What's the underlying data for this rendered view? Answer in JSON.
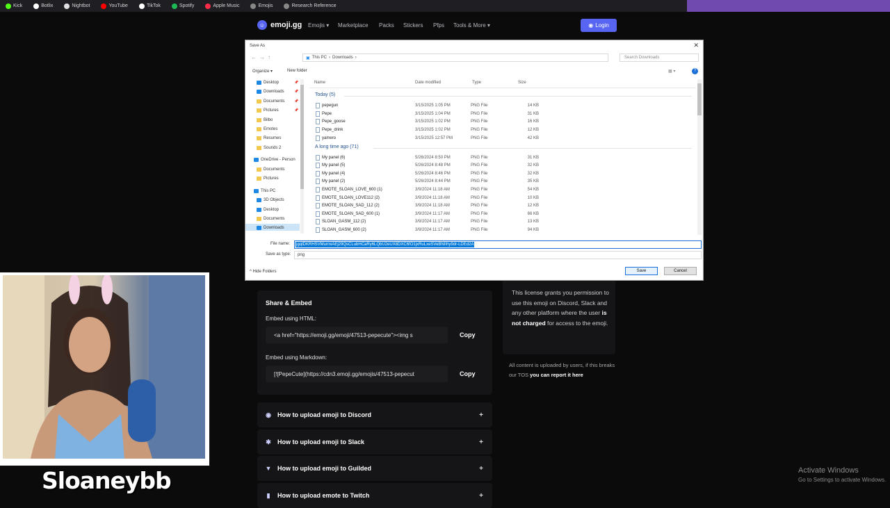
{
  "bookmarks": [
    {
      "label": "Kick",
      "color": "#53fc18"
    },
    {
      "label": "Botlix",
      "color": "#ffffff"
    },
    {
      "label": "Nightbot",
      "color": "#e0e0e0"
    },
    {
      "label": "YouTube",
      "color": "#ff0000"
    },
    {
      "label": "TikTok",
      "color": "#ffffff"
    },
    {
      "label": "Spotify",
      "color": "#1db954"
    },
    {
      "label": "Apple Music",
      "color": "#fa2d48"
    },
    {
      "label": "Emojis",
      "color": "#888888"
    },
    {
      "label": "Research Reference",
      "color": "#888888"
    }
  ],
  "site": {
    "logo_text": "emoji.gg",
    "nav": [
      "Emojis ▾",
      "Marketplace",
      "Packs",
      "Stickers",
      "Pfps",
      "Tools & More ▾"
    ],
    "login_label": "Login"
  },
  "dialog": {
    "title": "Save As",
    "close": "✕",
    "address": [
      "This PC",
      "›",
      "Downloads",
      "›"
    ],
    "search_placeholder": "Search Downloads",
    "organize": "Organize ▾",
    "new_folder": "New folder",
    "nav_items": [
      {
        "label": "Desktop",
        "icon": "folder-blue",
        "pinned": true
      },
      {
        "label": "Downloads",
        "icon": "download-arrow",
        "pinned": true
      },
      {
        "label": "Documents",
        "icon": "folder",
        "pinned": true
      },
      {
        "label": "Pictures",
        "icon": "folder",
        "pinned": true
      },
      {
        "label": "Bilbo",
        "icon": "folder",
        "pinned": false
      },
      {
        "label": "Emotes",
        "icon": "folder",
        "pinned": false
      },
      {
        "label": "Resumes",
        "icon": "folder",
        "pinned": false
      },
      {
        "label": "Sounds 2",
        "icon": "folder",
        "pinned": false
      },
      {
        "label": "OneDrive - Person",
        "icon": "cloud",
        "pinned": false
      },
      {
        "label": "Documents",
        "icon": "folder",
        "pinned": false
      },
      {
        "label": "Pictures",
        "icon": "folder",
        "pinned": false
      },
      {
        "label": "This PC",
        "icon": "pc",
        "pinned": false
      },
      {
        "label": "3D Objects",
        "icon": "folder-blue",
        "pinned": false
      },
      {
        "label": "Desktop",
        "icon": "folder-blue",
        "pinned": false
      },
      {
        "label": "Documents",
        "icon": "folder",
        "pinned": false
      },
      {
        "label": "Downloads",
        "icon": "download-arrow",
        "pinned": false
      }
    ],
    "columns": {
      "name": "Name",
      "date": "Date modified",
      "type": "Type",
      "size": "Size"
    },
    "groups": [
      {
        "label": "Today (5)",
        "files": [
          {
            "name": "pepegun",
            "date": "3/15/2025 1:05 PM",
            "type": "PNG File",
            "size": "14 KB"
          },
          {
            "name": "Pepe",
            "date": "3/15/2025 1:04 PM",
            "type": "PNG File",
            "size": "31 KB"
          },
          {
            "name": "Pepe_goose",
            "date": "3/15/2025 1:02 PM",
            "type": "PNG File",
            "size": "16 KB"
          },
          {
            "name": "Pepe_drink",
            "date": "3/15/2025 1:02 PM",
            "type": "PNG File",
            "size": "12 KB"
          },
          {
            "name": "yamero",
            "date": "3/15/2025 12:57 PM",
            "type": "PNG File",
            "size": "42 KB"
          }
        ]
      },
      {
        "label": "A long time ago (71)",
        "files": [
          {
            "name": "My panel (6)",
            "date": "5/26/2024 8:50 PM",
            "type": "PNG File",
            "size": "31 KB"
          },
          {
            "name": "My panel (5)",
            "date": "5/26/2024 8:48 PM",
            "type": "PNG File",
            "size": "32 KB"
          },
          {
            "name": "My panel (4)",
            "date": "5/26/2024 8:46 PM",
            "type": "PNG File",
            "size": "32 KB"
          },
          {
            "name": "My panel (2)",
            "date": "5/26/2024 8:44 PM",
            "type": "PNG File",
            "size": "35 KB"
          },
          {
            "name": "EMOTE_SLOAN_LOVE_600 (1)",
            "date": "3/9/2024 11:18 AM",
            "type": "PNG File",
            "size": "54 KB"
          },
          {
            "name": "EMOTE_SLOAN_LOVE112 (2)",
            "date": "3/9/2024 11:18 AM",
            "type": "PNG File",
            "size": "10 KB"
          },
          {
            "name": "EMOTE_SLOAN_SAD_112 (2)",
            "date": "3/9/2024 11:18 AM",
            "type": "PNG File",
            "size": "12 KB"
          },
          {
            "name": "EMOTE_SLOAN_SAD_600 (1)",
            "date": "3/9/2024 11:17 AM",
            "type": "PNG File",
            "size": "66 KB"
          },
          {
            "name": "SLOAN_GASM_112 (2)",
            "date": "3/9/2024 11:17 AM",
            "type": "PNG File",
            "size": "13 KB"
          },
          {
            "name": "SLOAN_GASM_600 (2)",
            "date": "3/9/2024 11:17 AM",
            "type": "PNG File",
            "size": "94 KB"
          }
        ]
      }
    ],
    "file_name_label": "File name:",
    "file_name_value": "jgqtDKRHSVMurmiAEj29QsCLubHCaRy6LQbU2eUX8DXC6fO1jxRuLxeSVeBNIIhy9dr-LDEd2A",
    "save_type_label": "Save as type:",
    "save_type_value": "png",
    "hide_folders": "Hide Folders",
    "save_label": "Save",
    "cancel_label": "Cancel"
  },
  "page": {
    "share_title": "Share & Embed",
    "html_label": "Embed using HTML:",
    "html_code": "<a href=\"https://emoji.gg/emoji/47513-pepecute\"><img s",
    "md_label": "Embed using Markdown:",
    "md_code": "[![PepeCute](https://cdn3.emoji.gg/emojis/47513-pepecut",
    "copy_label": "Copy",
    "license_lead": "This license grants you permission to use this emoji on Discord, Slack and any other platform where the user ",
    "license_bold1": "is not charged",
    "license_tail": " for access to the emoji.",
    "report_lead": "All content is uploaded by users, if this breaks our TOS ",
    "report_link": "you can report it here",
    "howto": [
      {
        "label": "How to upload emoji to Discord",
        "icon": "discord-icon"
      },
      {
        "label": "How to upload emoji to Slack",
        "icon": "slack-icon"
      },
      {
        "label": "How to upload emoji to Guilded",
        "icon": "guilded-icon"
      },
      {
        "label": "How to upload emote to Twitch",
        "icon": "twitch-icon"
      }
    ]
  },
  "overlay": {
    "streamer_name": "Sloaneybb",
    "activate_title": "Activate Windows",
    "activate_sub": "Go to Settings to activate Windows."
  }
}
